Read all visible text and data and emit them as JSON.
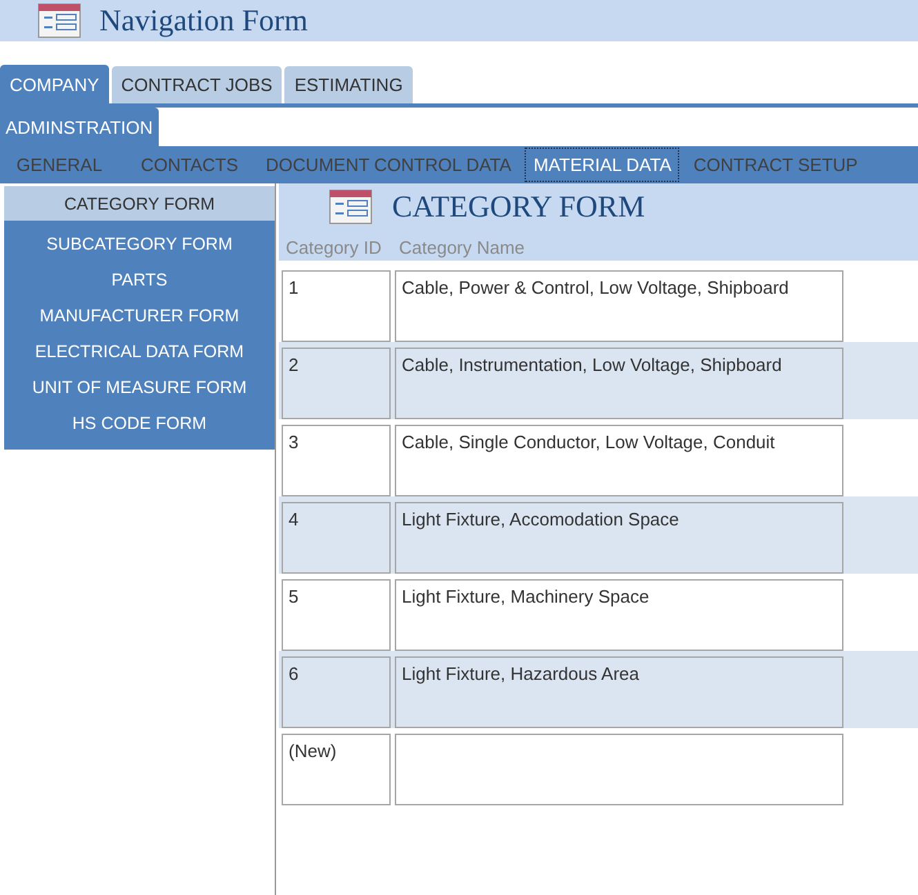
{
  "window": {
    "title": "Navigation Form"
  },
  "main_tabs": [
    {
      "label": "COMPANY",
      "selected": true
    },
    {
      "label": "CONTRACT JOBS",
      "selected": false
    },
    {
      "label": "ESTIMATING",
      "selected": false
    }
  ],
  "sub_tabs": [
    {
      "label": "ADMINSTRATION",
      "selected": true
    }
  ],
  "section_tabs": [
    {
      "label": "GENERAL",
      "selected": false
    },
    {
      "label": "CONTACTS",
      "selected": false
    },
    {
      "label": "DOCUMENT CONTROL DATA",
      "selected": false
    },
    {
      "label": "MATERIAL DATA",
      "selected": true
    },
    {
      "label": "CONTRACT SETUP",
      "selected": false
    }
  ],
  "sidebar": {
    "items": [
      {
        "label": "CATEGORY FORM",
        "selected": true
      },
      {
        "label": "SUBCATEGORY FORM",
        "selected": false
      },
      {
        "label": "PARTS",
        "selected": false
      },
      {
        "label": "MANUFACTURER FORM",
        "selected": false
      },
      {
        "label": "ELECTRICAL DATA FORM",
        "selected": false
      },
      {
        "label": "UNIT OF MEASURE FORM",
        "selected": false
      },
      {
        "label": "HS CODE FORM",
        "selected": false
      }
    ]
  },
  "form": {
    "title": "CATEGORY FORM",
    "columns": [
      "Category ID",
      "Category Name"
    ],
    "rows": [
      {
        "id": "1",
        "name": "Cable, Power & Control, Low Voltage, Shipboard"
      },
      {
        "id": "2",
        "name": "Cable, Instrumentation, Low Voltage, Shipboard"
      },
      {
        "id": "3",
        "name": "Cable, Single Conductor, Low Voltage, Conduit"
      },
      {
        "id": "4",
        "name": "Light Fixture, Accomodation Space"
      },
      {
        "id": "5",
        "name": "Light Fixture, Machinery Space"
      },
      {
        "id": "6",
        "name": "Light Fixture, Hazardous Area"
      },
      {
        "id": "(New)"
      }
    ]
  }
}
